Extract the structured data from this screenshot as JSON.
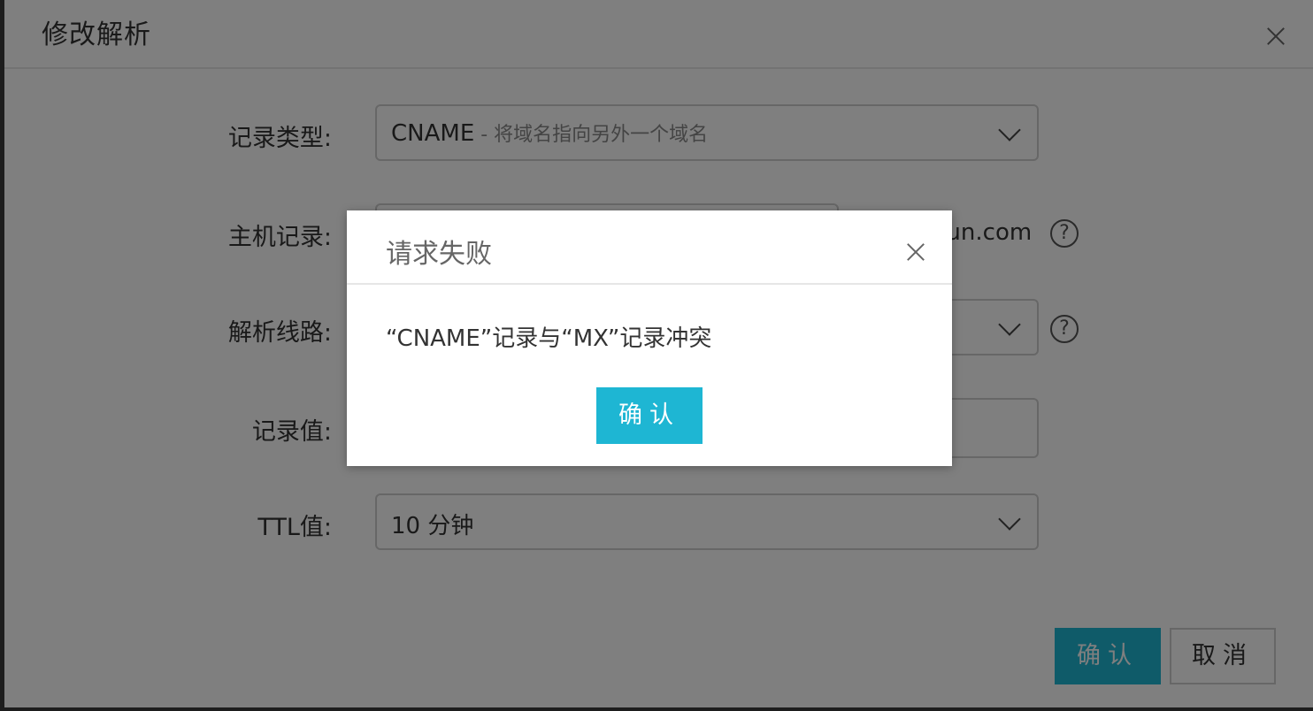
{
  "edit_dialog": {
    "title": "修改解析",
    "fields": {
      "record_type": {
        "label": "记录类型:",
        "value": "CNAME",
        "hint": " - 将域名指向另外一个域名"
      },
      "host_record": {
        "label": "主机记录:",
        "suffix": "lanqiaojun.com"
      },
      "resolve_line": {
        "label": "解析线路:"
      },
      "record_value": {
        "label": "记录值:"
      },
      "ttl": {
        "label": "TTL值:",
        "value": "10 分钟"
      }
    },
    "confirm_label": "确认",
    "cancel_label": "取消"
  },
  "alert": {
    "title": "请求失败",
    "message": "“CNAME”记录与“MX”记录冲突",
    "confirm_label": "确认"
  },
  "colors": {
    "primary": "#1eb6d3",
    "overlay": "rgba(0,0,0,0.5)"
  },
  "icons": {
    "close": "close-icon",
    "help": "help-icon",
    "chevron": "chevron-down-icon"
  }
}
